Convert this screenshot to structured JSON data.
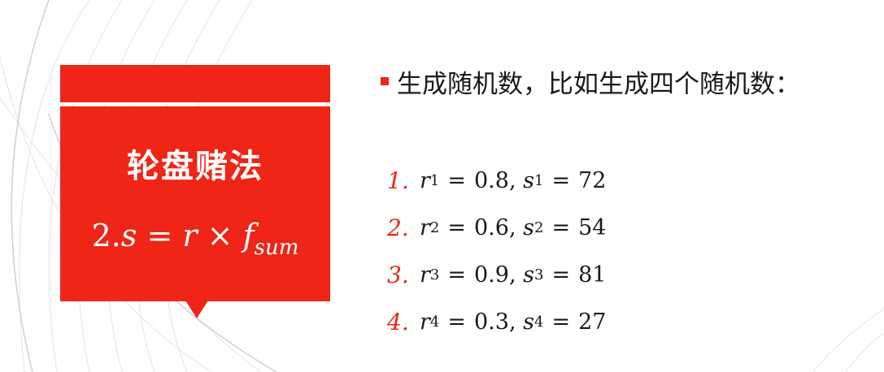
{
  "left_panel": {
    "title": "轮盘赌法",
    "formula": {
      "step": "2.",
      "s": "s",
      "eq": "=",
      "r": "r",
      "times": "×",
      "f": "f",
      "f_sub": "sum"
    }
  },
  "right_panel": {
    "heading": "生成随机数，比如生成四个随机数：",
    "items": [
      {
        "index": "1.",
        "r_sub": "1",
        "r_val": "0.8",
        "s_sub": "1",
        "s_val": "72"
      },
      {
        "index": "2.",
        "r_sub": "2",
        "r_val": "0.6",
        "s_sub": "2",
        "s_val": "54"
      },
      {
        "index": "3.",
        "r_sub": "3",
        "r_val": "0.9",
        "s_sub": "3",
        "s_val": "81"
      },
      {
        "index": "4.",
        "r_sub": "4",
        "r_val": "0.3",
        "s_sub": "4",
        "s_val": "27"
      }
    ]
  },
  "colors": {
    "accent": "#ee2517",
    "text": "#1a1a1a",
    "background": "#ffffff"
  }
}
